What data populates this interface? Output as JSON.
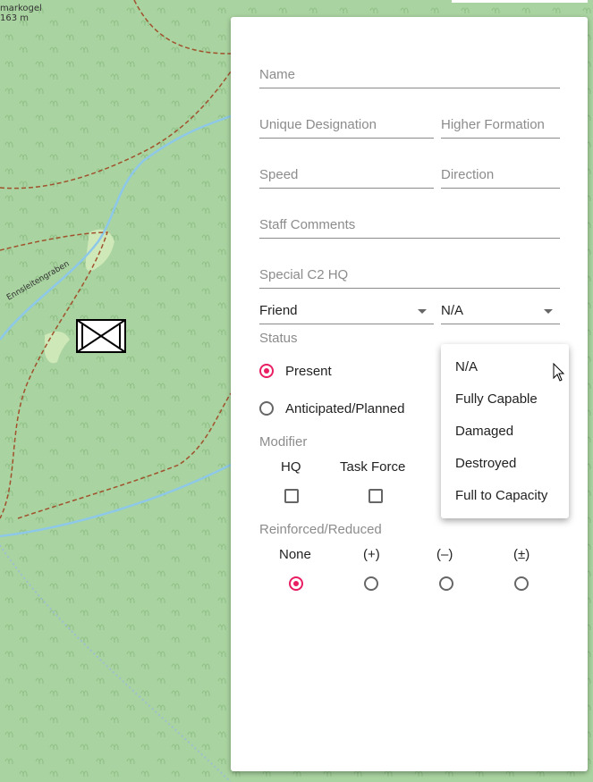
{
  "map": {
    "peak_name": "markoɡel",
    "peak_elevation": "163 m",
    "stream_name": "Ennsleitengraben"
  },
  "form": {
    "name_placeholder": "Name",
    "unique_designation_placeholder": "Unique Designation",
    "higher_formation_placeholder": "Higher Formation",
    "speed_placeholder": "Speed",
    "direction_placeholder": "Direction",
    "staff_comments_placeholder": "Staff Comments",
    "special_c2_hq_placeholder": "Special C2 HQ",
    "affiliation_value": "Friend",
    "capability_value": "N/A",
    "status_label": "Status",
    "status_options": [
      "Present",
      "Anticipated/Planned"
    ],
    "status_selected": "Present",
    "modifier_label": "Modifier",
    "modifier_options": [
      "HQ",
      "Task Force"
    ],
    "reinforced_label": "Reinforced/Reduced",
    "reinforced_options": [
      "None",
      "(+)",
      "(–)",
      "(±)"
    ],
    "reinforced_selected": "None"
  },
  "menu": {
    "items": [
      "N/A",
      "Fully Capable",
      "Damaged",
      "Destroyed",
      "Full to Capacity"
    ]
  },
  "colors": {
    "accent": "#e91e63",
    "map_background": "#a9d3a0",
    "stream": "#8ec8e8",
    "trail": "#a0522d"
  },
  "icons": {
    "unit_symbol": "friendly-unit-symbol-icon",
    "cursor": "mouse-pointer-icon"
  }
}
